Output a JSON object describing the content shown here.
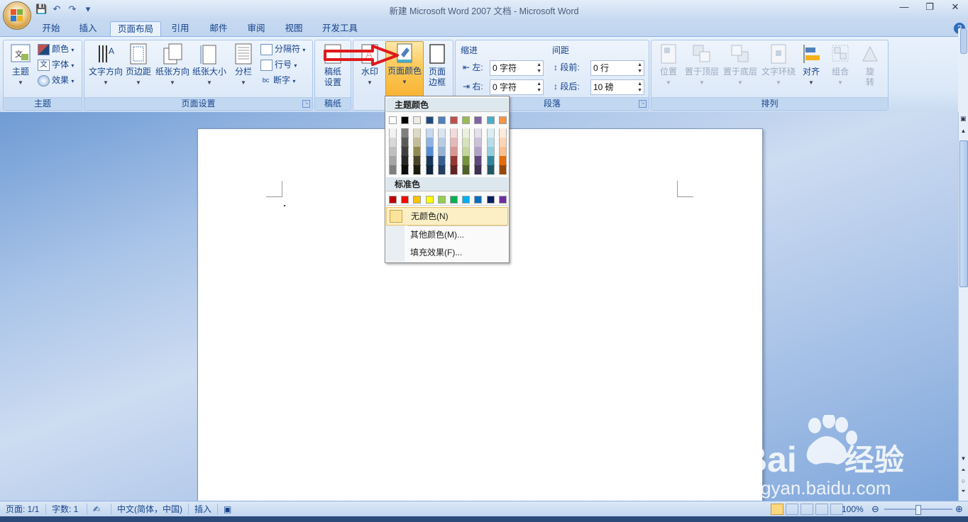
{
  "window": {
    "title": "新建 Microsoft Word 2007 文档 - Microsoft Word",
    "controls": [
      "—",
      "❐",
      "✕"
    ]
  },
  "qat": {
    "icons": [
      "save-icon",
      "undo-icon",
      "redo-icon",
      "customize-icon"
    ],
    "glyphs": [
      "💾",
      "↶",
      "↷",
      "▾"
    ]
  },
  "tabs": [
    "开始",
    "插入",
    "页面布局",
    "引用",
    "邮件",
    "审阅",
    "视图",
    "开发工具"
  ],
  "active_tab": "页面布局",
  "ribbon": {
    "theme_group": {
      "label": "主题",
      "theme_btn": "主题",
      "colors": "颜色",
      "fonts": "字体",
      "effects": "效果"
    },
    "page_setup_group": {
      "label": "页面设置",
      "text_direction": "文字方向",
      "margins": "页边距",
      "orientation": "纸张方向",
      "size": "纸张大小",
      "columns": "分栏",
      "breaks": "分隔符",
      "line_numbers": "行号",
      "hyphenation": "断字"
    },
    "draft_group": {
      "label": "稿纸",
      "draft_settings_1": "稿纸",
      "draft_settings_2": "设置"
    },
    "background_group": {
      "watermark": "水印",
      "page_color": "页面颜色",
      "page_borders_1": "页面",
      "page_borders_2": "边框"
    },
    "paragraph_group": {
      "label": "段落",
      "indent": "缩进",
      "spacing": "间距",
      "left": "左:",
      "right": "右:",
      "before": "段前:",
      "after": "段后:",
      "left_val": "0 字符",
      "right_val": "0 字符",
      "before_val": "0 行",
      "after_val": "10 磅"
    },
    "arrange_group": {
      "label": "排列",
      "position": "位置",
      "bring_front": "置于顶层",
      "send_back": "置于底层",
      "text_wrap": "文字环绕",
      "align": "对齐",
      "group": "组合",
      "rotate_1": "旋",
      "rotate_2": "转"
    }
  },
  "page_color_menu": {
    "theme_colors_header": "主题颜色",
    "standard_colors_header": "标准色",
    "theme_top": [
      "#ffffff",
      "#000000",
      "#eeece1",
      "#1f497d",
      "#4f81bd",
      "#c0504d",
      "#9bbb59",
      "#8064a2",
      "#4bacc6",
      "#f79646"
    ],
    "theme_shades": [
      [
        "#f2f2f2",
        "#d8d8d8",
        "#bfbfbf",
        "#a5a5a5",
        "#7f7f7f"
      ],
      [
        "#7f7f7f",
        "#595959",
        "#3f3f3f",
        "#262626",
        "#0c0c0c"
      ],
      [
        "#ddd9c3",
        "#c4bd97",
        "#938953",
        "#494429",
        "#1d1b10"
      ],
      [
        "#c6d9f0",
        "#8db3e2",
        "#548dd4",
        "#17365d",
        "#0f243e"
      ],
      [
        "#dbe5f1",
        "#b8cce4",
        "#95b3d7",
        "#366092",
        "#244061"
      ],
      [
        "#f2dcdb",
        "#e5b9b7",
        "#d99694",
        "#953734",
        "#632423"
      ],
      [
        "#ebf1dd",
        "#d7e3bc",
        "#c3d69b",
        "#76923c",
        "#4f6128"
      ],
      [
        "#e5e0ec",
        "#ccc1d9",
        "#b2a2c7",
        "#5f497a",
        "#3f3151"
      ],
      [
        "#dbeef3",
        "#b7dde8",
        "#92cddc",
        "#31859b",
        "#205867"
      ],
      [
        "#fdeada",
        "#fbd5b5",
        "#fac08f",
        "#e36c09",
        "#974806"
      ]
    ],
    "standard": [
      "#c00000",
      "#ff0000",
      "#ffc000",
      "#ffff00",
      "#92d050",
      "#00b050",
      "#00b0f0",
      "#0070c0",
      "#002060",
      "#7030a0"
    ],
    "no_color": "无颜色(N)",
    "more_colors": "其他颜色(M)...",
    "fill_effects": "填充效果(F)..."
  },
  "status": {
    "page": "页面: 1/1",
    "words": "字数: 1",
    "language": "中文(简体，中国)",
    "mode": "插入",
    "zoom": "100%"
  },
  "watermark": {
    "brand": "Bai du 经验",
    "url": "jingyan.baidu.com"
  },
  "colors": {
    "accent": "#15428b",
    "arrow": "#e0191c"
  }
}
